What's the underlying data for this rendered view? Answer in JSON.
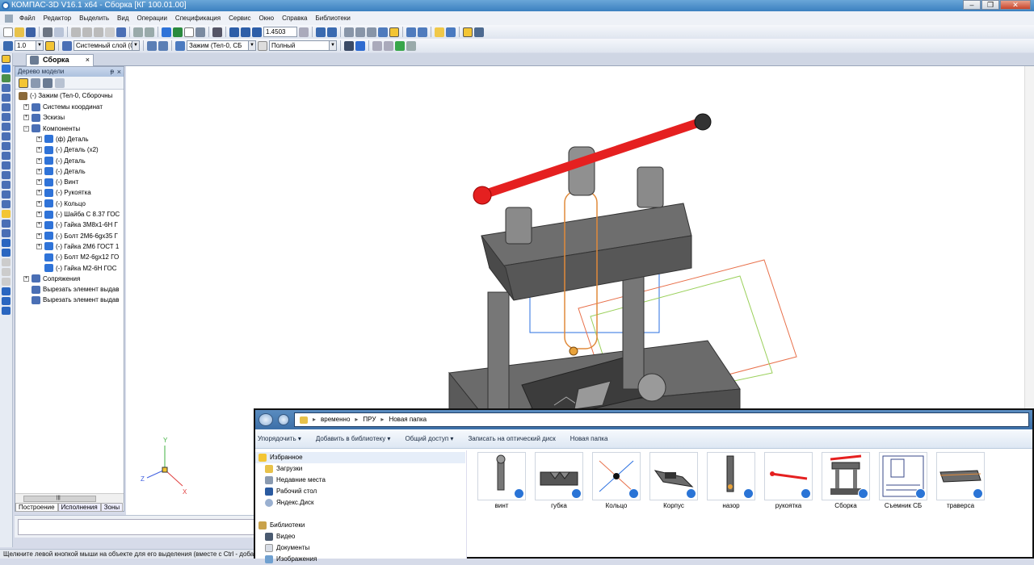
{
  "window": {
    "title": "КОМПАС-3D V16.1 x64 - Сборка [КГ 100.01.00]",
    "minimize": "–",
    "restore": "❐",
    "close": "✕"
  },
  "menu": [
    "Файл",
    "Редактор",
    "Выделить",
    "Вид",
    "Операции",
    "Спецификация",
    "Сервис",
    "Окно",
    "Справка",
    "Библиотеки"
  ],
  "toolbar": {
    "zoom": "1.4503",
    "step": "1.0",
    "layer": "Системный слой (0)",
    "part": "Зажим (Тел-0, СБ",
    "style": "Полный"
  },
  "doc_tab": {
    "label": "Сборка",
    "close": "×"
  },
  "tree_panel": {
    "title": "Дерево модели",
    "pin": "ᵽ",
    "close": "×",
    "root": "(-) Зажим (Тел-0, Сборочны",
    "nodes": [
      {
        "label": "Системы координат",
        "level": 1,
        "exp": "+"
      },
      {
        "label": "Эскизы",
        "level": 1,
        "exp": "+"
      },
      {
        "label": "Компоненты",
        "level": 1,
        "exp": "−"
      },
      {
        "label": "(ф) Деталь",
        "level": 2,
        "exp": "+"
      },
      {
        "label": "(-) Деталь (x2)",
        "level": 2,
        "exp": "+"
      },
      {
        "label": "(-) Деталь",
        "level": 2,
        "exp": "+"
      },
      {
        "label": "(-) Деталь",
        "level": 2,
        "exp": "+"
      },
      {
        "label": "(-) Винт",
        "level": 2,
        "exp": "+"
      },
      {
        "label": "(-) Рукоятка",
        "level": 2,
        "exp": "+"
      },
      {
        "label": "(-) Кольцо",
        "level": 2,
        "exp": "+"
      },
      {
        "label": "(-) Шайба С 8.37 ГОС",
        "level": 2,
        "exp": "+"
      },
      {
        "label": "(-) Гайка 3М8х1-6Н Г",
        "level": 2,
        "exp": "+"
      },
      {
        "label": "(-) Болт 2М6-6gx35 Г",
        "level": 2,
        "exp": "+"
      },
      {
        "label": "(-) Гайка 2М6 ГОСТ 1",
        "level": 2,
        "exp": "+"
      },
      {
        "label": "(-) Болт М2-6gx12 ГО",
        "level": 2,
        "exp": ""
      },
      {
        "label": "(-) Гайка М2-6Н ГОС",
        "level": 2,
        "exp": ""
      },
      {
        "label": "Сопряжения",
        "level": 1,
        "exp": "+"
      },
      {
        "label": "Вырезать элемент выдав",
        "level": 1,
        "exp": ""
      },
      {
        "label": "Вырезать элемент выдав",
        "level": 1,
        "exp": ""
      }
    ],
    "bottom_tabs": [
      "Построение",
      "Исполнения",
      "Зоны"
    ],
    "scroll_glyph": "|||"
  },
  "viewport": {
    "axis_x": "X",
    "axis_y": "Y",
    "axis_z": "Z"
  },
  "status": "Щелкните левой кнопкой мыши на объекте для его выделения (вместе с Ctrl - добавить к",
  "explorer": {
    "path": [
      "временно",
      "ПРУ",
      "Новая папка"
    ],
    "commands": [
      "Упорядочить ▾",
      "Добавить в библиотеку ▾",
      "Общий доступ ▾",
      "Записать на оптический диск",
      "Новая папка"
    ],
    "nav": [
      "Избранное",
      "Загрузки",
      "Недавние места",
      "Рабочий стол",
      "Яндекс.Диск",
      "Библиотеки",
      "Видео",
      "Документы",
      "Изображения"
    ],
    "files": [
      "винт",
      "губка",
      "Кольцо",
      "Корпус",
      "назор",
      "рукоятка",
      "Сборка",
      "Съемник СБ",
      "траверса"
    ]
  }
}
